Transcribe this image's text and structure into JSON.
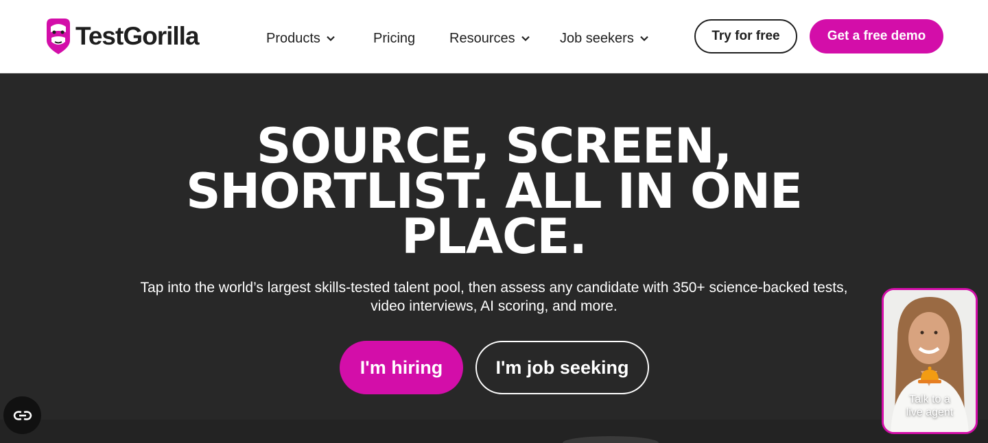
{
  "brand": {
    "name": "TestGorilla",
    "accent": "#d30ea9",
    "dark": "#282828"
  },
  "nav": {
    "items": [
      {
        "label": "Products",
        "dropdown": true
      },
      {
        "label": "Pricing",
        "dropdown": false
      },
      {
        "label": "Resources",
        "dropdown": true
      },
      {
        "label": "Job seekers",
        "dropdown": true
      }
    ],
    "try_label": "Try for free",
    "demo_label": "Get a free demo"
  },
  "hero": {
    "title_line1": "SOURCE, SCREEN,",
    "title_line2": "SHORTLIST. ALL IN ONE",
    "title_line3": "PLACE.",
    "subtitle_line1": "Tap into the world’s largest skills-tested talent pool, then assess any candidate with 350+ science-backed tests,",
    "subtitle_line2": "video interviews, AI scoring, and more.",
    "cta_hiring": "I'm hiring",
    "cta_seeking": "I'm job seeking"
  },
  "widgets": {
    "accessibility_icon": "accessibility-icon",
    "agent_line1": "Talk to a",
    "agent_line2": "live agent"
  }
}
